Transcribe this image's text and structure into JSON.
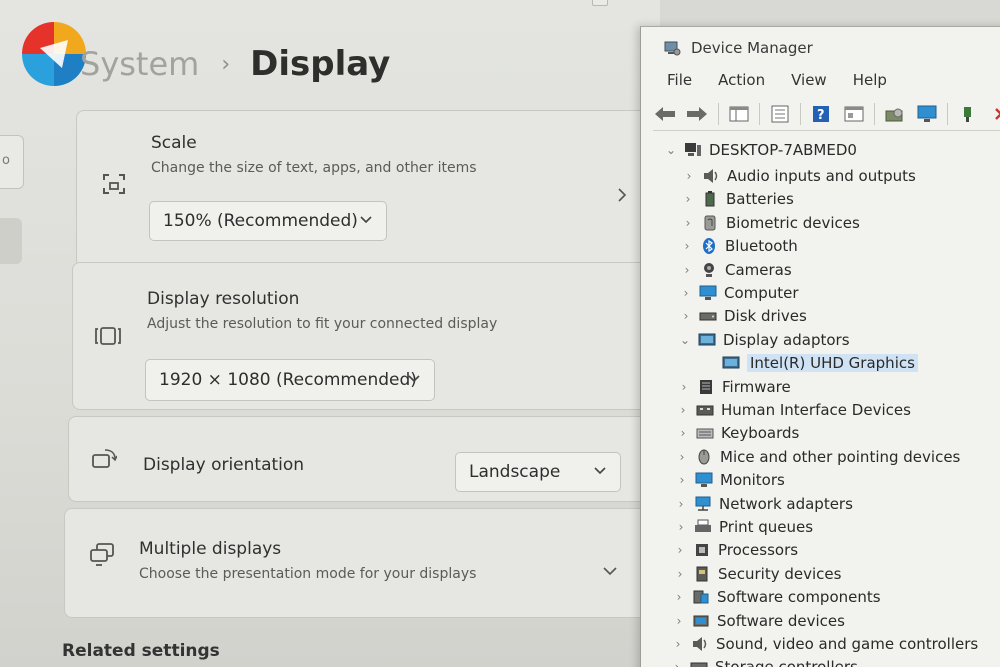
{
  "settings": {
    "breadcrumb": {
      "parent": "System",
      "separator": "›",
      "current": "Display"
    },
    "nav_stub_glyph": "o",
    "cards": {
      "scale": {
        "title": "Scale",
        "description": "Change the size of text, apps, and other items",
        "dropdown_value": "150% (Recommended)",
        "icon": "scale-icon"
      },
      "resolution": {
        "title": "Display resolution",
        "description": "Adjust the resolution to fit your connected display",
        "dropdown_value": "1920 × 1080 (Recommended)",
        "icon": "resolution-icon"
      },
      "orientation": {
        "title": "Display orientation",
        "dropdown_value": "Landscape",
        "icon": "orientation-icon"
      },
      "multiple": {
        "title": "Multiple displays",
        "description": "Choose the presentation mode for your displays",
        "icon": "multiple-displays-icon"
      }
    },
    "related_settings": "Related settings"
  },
  "device_manager": {
    "title": "Device Manager",
    "menu": [
      "File",
      "Action",
      "View",
      "Help"
    ],
    "root": "DESKTOP-7ABMED0",
    "items": [
      {
        "label": "Audio inputs and outputs",
        "icon": "speaker-icon"
      },
      {
        "label": "Batteries",
        "icon": "battery-icon"
      },
      {
        "label": "Biometric devices",
        "icon": "fingerprint-icon"
      },
      {
        "label": "Bluetooth",
        "icon": "bluetooth-icon"
      },
      {
        "label": "Cameras",
        "icon": "camera-icon"
      },
      {
        "label": "Computer",
        "icon": "computer-icon"
      },
      {
        "label": "Disk drives",
        "icon": "disk-icon"
      },
      {
        "label": "Display adaptors",
        "icon": "display-adapter-icon",
        "expanded": true
      },
      {
        "label": "Intel(R) UHD Graphics",
        "icon": "display-adapter-icon",
        "child": true,
        "selected": true
      },
      {
        "label": "Firmware",
        "icon": "firmware-icon"
      },
      {
        "label": "Human Interface Devices",
        "icon": "hid-icon"
      },
      {
        "label": "Keyboards",
        "icon": "keyboard-icon"
      },
      {
        "label": "Mice and other pointing devices",
        "icon": "mouse-icon"
      },
      {
        "label": "Monitors",
        "icon": "monitor-icon"
      },
      {
        "label": "Network adapters",
        "icon": "network-icon"
      },
      {
        "label": "Print queues",
        "icon": "printer-icon"
      },
      {
        "label": "Processors",
        "icon": "processor-icon"
      },
      {
        "label": "Security devices",
        "icon": "security-icon"
      },
      {
        "label": "Software components",
        "icon": "software-component-icon"
      },
      {
        "label": "Software devices",
        "icon": "software-device-icon"
      },
      {
        "label": "Sound, video and game controllers",
        "icon": "sound-icon"
      },
      {
        "label": "Storage controllers",
        "icon": "storage-icon"
      }
    ]
  }
}
